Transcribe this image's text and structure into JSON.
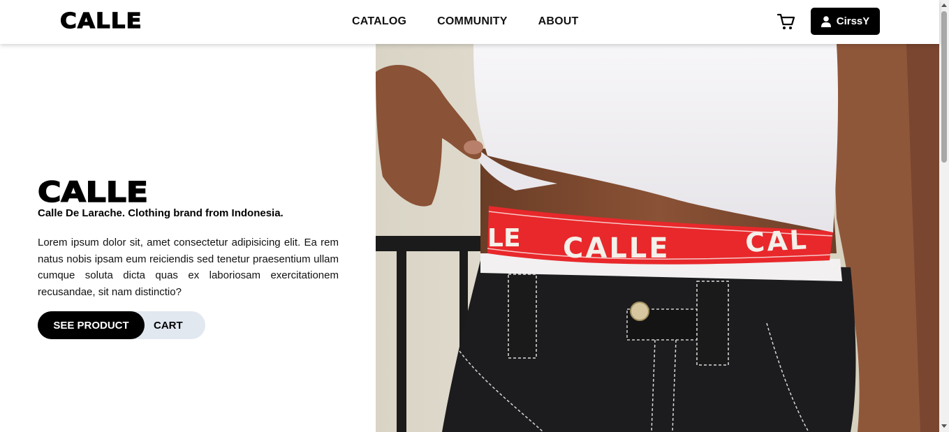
{
  "navbar": {
    "logo": "CALLE",
    "links": [
      "CATALOG",
      "COMMUNITY",
      "ABOUT"
    ],
    "cart_icon": "cart-icon",
    "user": {
      "icon": "user-icon",
      "name": "CirssY"
    }
  },
  "hero": {
    "title": "CALLE",
    "tagline": "Calle De Larache. Clothing brand from Indonesia.",
    "description": "Lorem ipsum dolor sit, amet consectetur adipisicing elit. Ea rem natus nobis ipsam eum reiciendis sed tenetur praesentium ullam cumque soluta dicta quas ex laboriosam exercitationem recusandae, sit nam distinctio?",
    "primary_button": "SEE PRODUCT",
    "secondary_button": "CART",
    "image": {
      "waistband_text": "CALLE",
      "waistband_color": "#e8282b",
      "shirt_color": "#f4f2f4",
      "jeans_color": "#1c1c1e"
    }
  },
  "colors": {
    "accent": "#000000",
    "button_group_bg": "#e2e8f0"
  }
}
